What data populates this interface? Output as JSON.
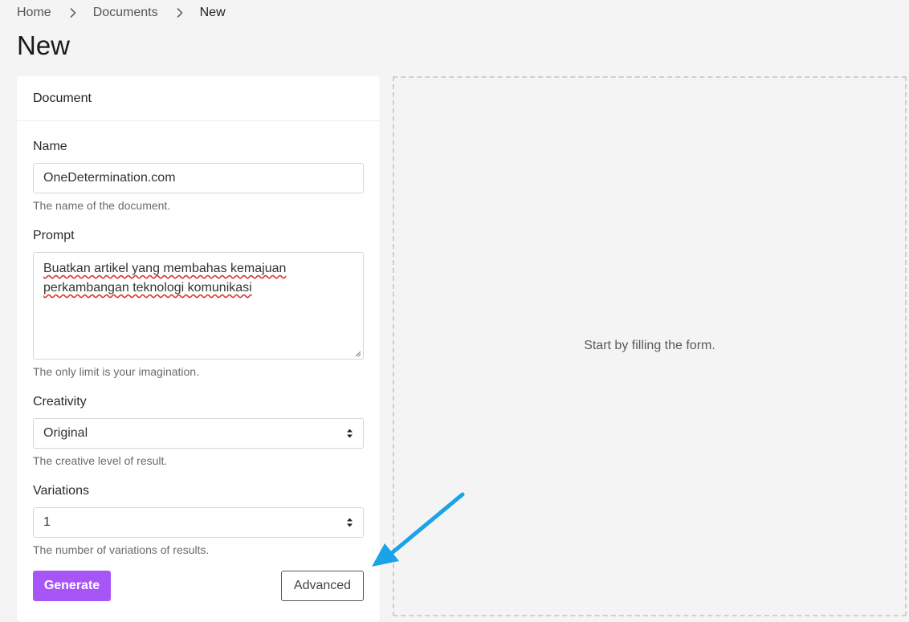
{
  "breadcrumb": {
    "items": [
      "Home",
      "Documents",
      "New"
    ]
  },
  "page": {
    "title": "New"
  },
  "form": {
    "card_title": "Document",
    "name": {
      "label": "Name",
      "value": "OneDetermination.com",
      "help": "The name of the document."
    },
    "prompt": {
      "label": "Prompt",
      "value": "Buatkan artikel yang membahas kemajuan perkambangan teknologi komunikasi",
      "help": "The only limit is your imagination."
    },
    "creativity": {
      "label": "Creativity",
      "value": "Original",
      "help": "The creative level of result."
    },
    "variations": {
      "label": "Variations",
      "value": "1",
      "help": "The number of variations of results."
    },
    "generate_label": "Generate",
    "advanced_label": "Advanced"
  },
  "result": {
    "empty_message": "Start by filling the form."
  },
  "colors": {
    "accent": "#a855f7",
    "annotation_arrow": "#1aa3e8",
    "background": "#f4f4f4"
  },
  "icons": {
    "breadcrumb_separator": "chevron-right-icon",
    "select_indicator": "sort-arrows-icon",
    "annotation": "arrow-icon"
  }
}
